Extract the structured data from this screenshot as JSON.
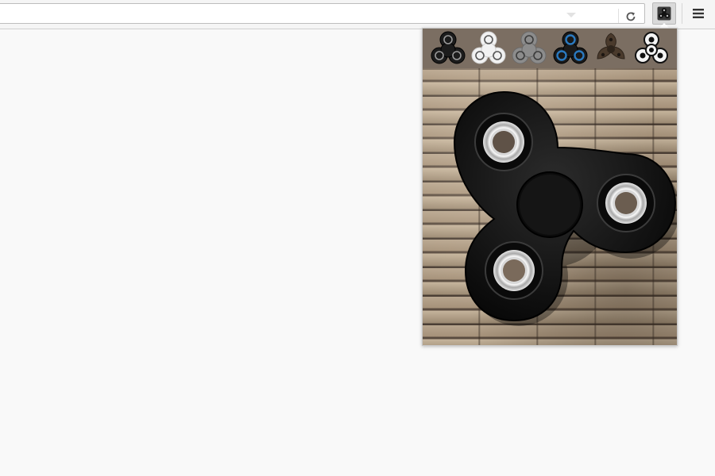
{
  "toolbar": {
    "url_value": "",
    "reload_icon": "reload-icon",
    "extension_icon": "fidget-spinner-icon",
    "menu_icon": "hamburger-menu-icon"
  },
  "popup": {
    "spinner_options": [
      {
        "name": "black-spinner-option",
        "color": "#1c1c1c"
      },
      {
        "name": "white-spinner-option",
        "color": "#f2f2f2"
      },
      {
        "name": "gray-spinner-option",
        "color": "#8c8c8c"
      },
      {
        "name": "blue-spinner-option",
        "color": "#1f5f9c"
      },
      {
        "name": "brown-spinner-option",
        "color": "#4a3a2c"
      },
      {
        "name": "outline-spinner-option",
        "color": "#111111"
      }
    ],
    "selected_spinner": "black-spinner-option",
    "background": "stone-wall"
  }
}
